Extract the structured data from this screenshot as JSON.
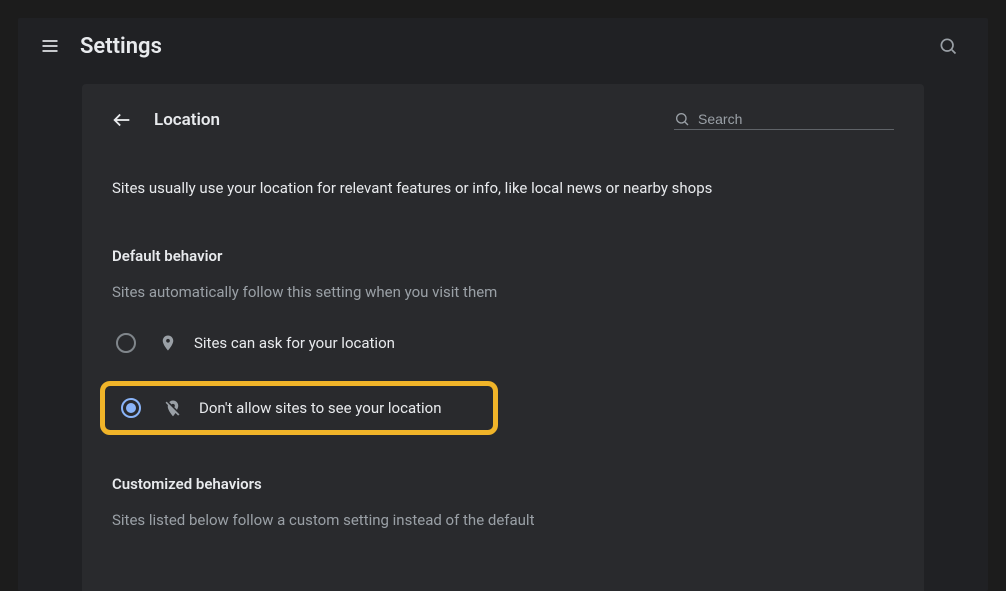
{
  "topbar": {
    "title": "Settings"
  },
  "panel": {
    "title": "Location",
    "search_placeholder": "Search",
    "description": "Sites usually use your location for relevant features or info, like local news or nearby shops"
  },
  "default_behavior": {
    "title": "Default behavior",
    "subtitle": "Sites automatically follow this setting when you visit them",
    "options": [
      {
        "label": "Sites can ask for your location",
        "selected": false
      },
      {
        "label": "Don't allow sites to see your location",
        "selected": true
      }
    ]
  },
  "customized": {
    "title": "Customized behaviors",
    "subtitle": "Sites listed below follow a custom setting instead of the default"
  },
  "colors": {
    "highlight": "#f0b429",
    "accent": "#8ab4f8"
  }
}
